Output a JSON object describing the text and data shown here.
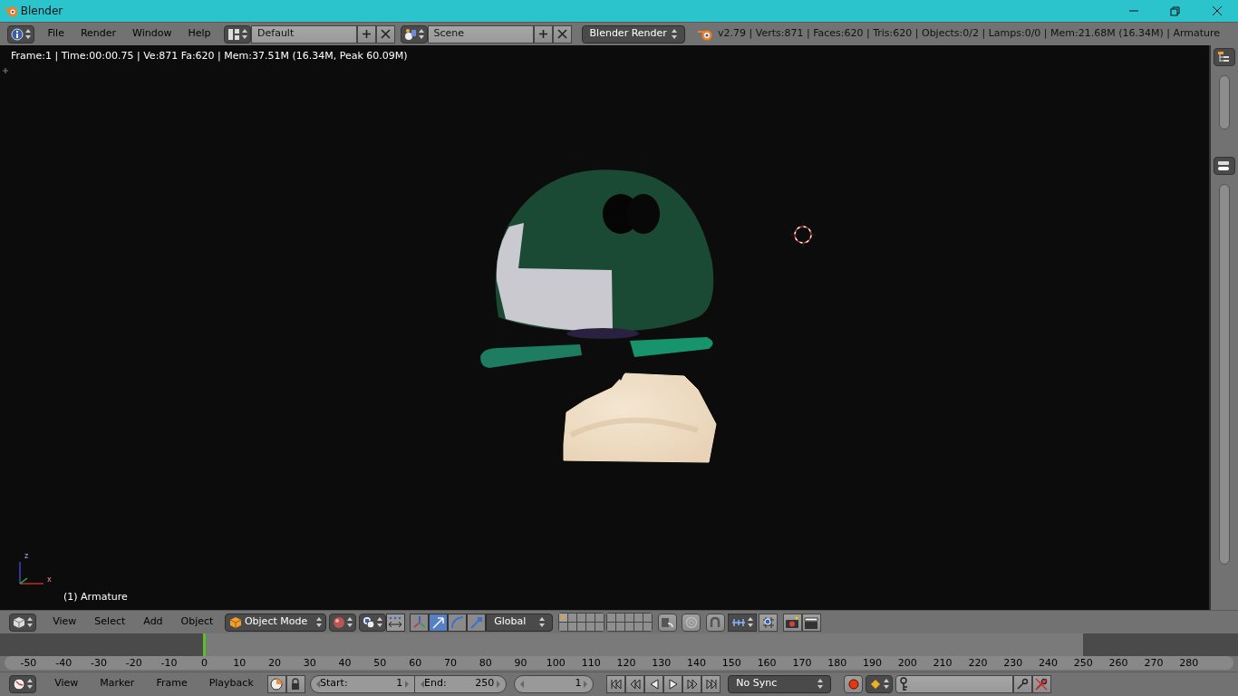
{
  "window": {
    "title": "Blender"
  },
  "info_header": {
    "menus": [
      "File",
      "Render",
      "Window",
      "Help"
    ],
    "layout": "Default",
    "scene": "Scene",
    "render_engine": "Blender Render",
    "stats": "v2.79 | Verts:871 | Faces:620 | Tris:620 | Objects:0/2 | Lamps:0/0 | Mem:21.68M (16.34M) | Armature"
  },
  "viewport": {
    "overlay": "Frame:1 | Time:00:00.75 | Ve:871 Fa:620 | Mem:37.51M (16.34M, Peak 60.09M)",
    "axis_labels": [
      "z",
      "x"
    ],
    "object_label": "(1) Armature"
  },
  "view3d_header": {
    "menus": [
      "View",
      "Select",
      "Add",
      "Object"
    ],
    "mode": "Object Mode",
    "manipulators": [
      {
        "selected": false
      },
      {
        "selected": true
      },
      {
        "selected": false
      },
      {
        "selected": false
      }
    ],
    "orientation": "Global",
    "layers": [
      {
        "selected": true
      },
      {
        "selected": false
      },
      {
        "selected": false
      },
      {
        "selected": false
      },
      {
        "selected": false
      },
      {
        "selected": false
      },
      {
        "selected": false
      },
      {
        "selected": false
      },
      {
        "selected": false
      },
      {
        "selected": false
      },
      {
        "selected": false
      },
      {
        "selected": false
      },
      {
        "selected": false
      },
      {
        "selected": false
      },
      {
        "selected": false
      },
      {
        "selected": false
      },
      {
        "selected": false
      },
      {
        "selected": false
      },
      {
        "selected": false
      },
      {
        "selected": false
      }
    ]
  },
  "timeline": {
    "ticks": [
      "-50",
      "-40",
      "-30",
      "-20",
      "-10",
      "0",
      "10",
      "20",
      "30",
      "40",
      "50",
      "60",
      "70",
      "80",
      "90",
      "100",
      "110",
      "120",
      "130",
      "140",
      "150",
      "160",
      "170",
      "180",
      "190",
      "200",
      "210",
      "220",
      "230",
      "240",
      "250",
      "260",
      "270",
      "280"
    ]
  },
  "timeline_header": {
    "menus": [
      "View",
      "Marker",
      "Frame",
      "Playback"
    ],
    "start_label": "Start:",
    "start": "1",
    "end_label": "End:",
    "end": "250",
    "current_frame": "1",
    "sync": "No Sync"
  }
}
